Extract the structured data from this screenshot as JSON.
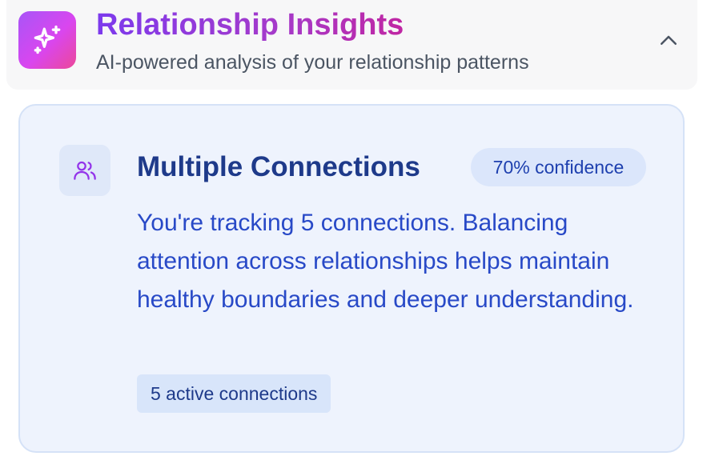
{
  "header": {
    "icon": "sparkles-icon",
    "title": "Relationship Insights",
    "subtitle": "AI-powered analysis of your relationship patterns",
    "collapse_icon": "chevron-up-icon"
  },
  "insight": {
    "icon": "users-icon",
    "title": "Multiple Connections",
    "confidence": "70% confidence",
    "body": "You're tracking 5 connections. Balancing attention across relationships helps maintain healthy boundaries and deeper understanding.",
    "tag": "5 active connections"
  },
  "colors": {
    "brand_gradient_start": "#a855f7",
    "brand_gradient_end": "#ec4899",
    "card_background": "#eef3fd",
    "card_text": "#2849c7",
    "card_title": "#1e3a8a"
  }
}
